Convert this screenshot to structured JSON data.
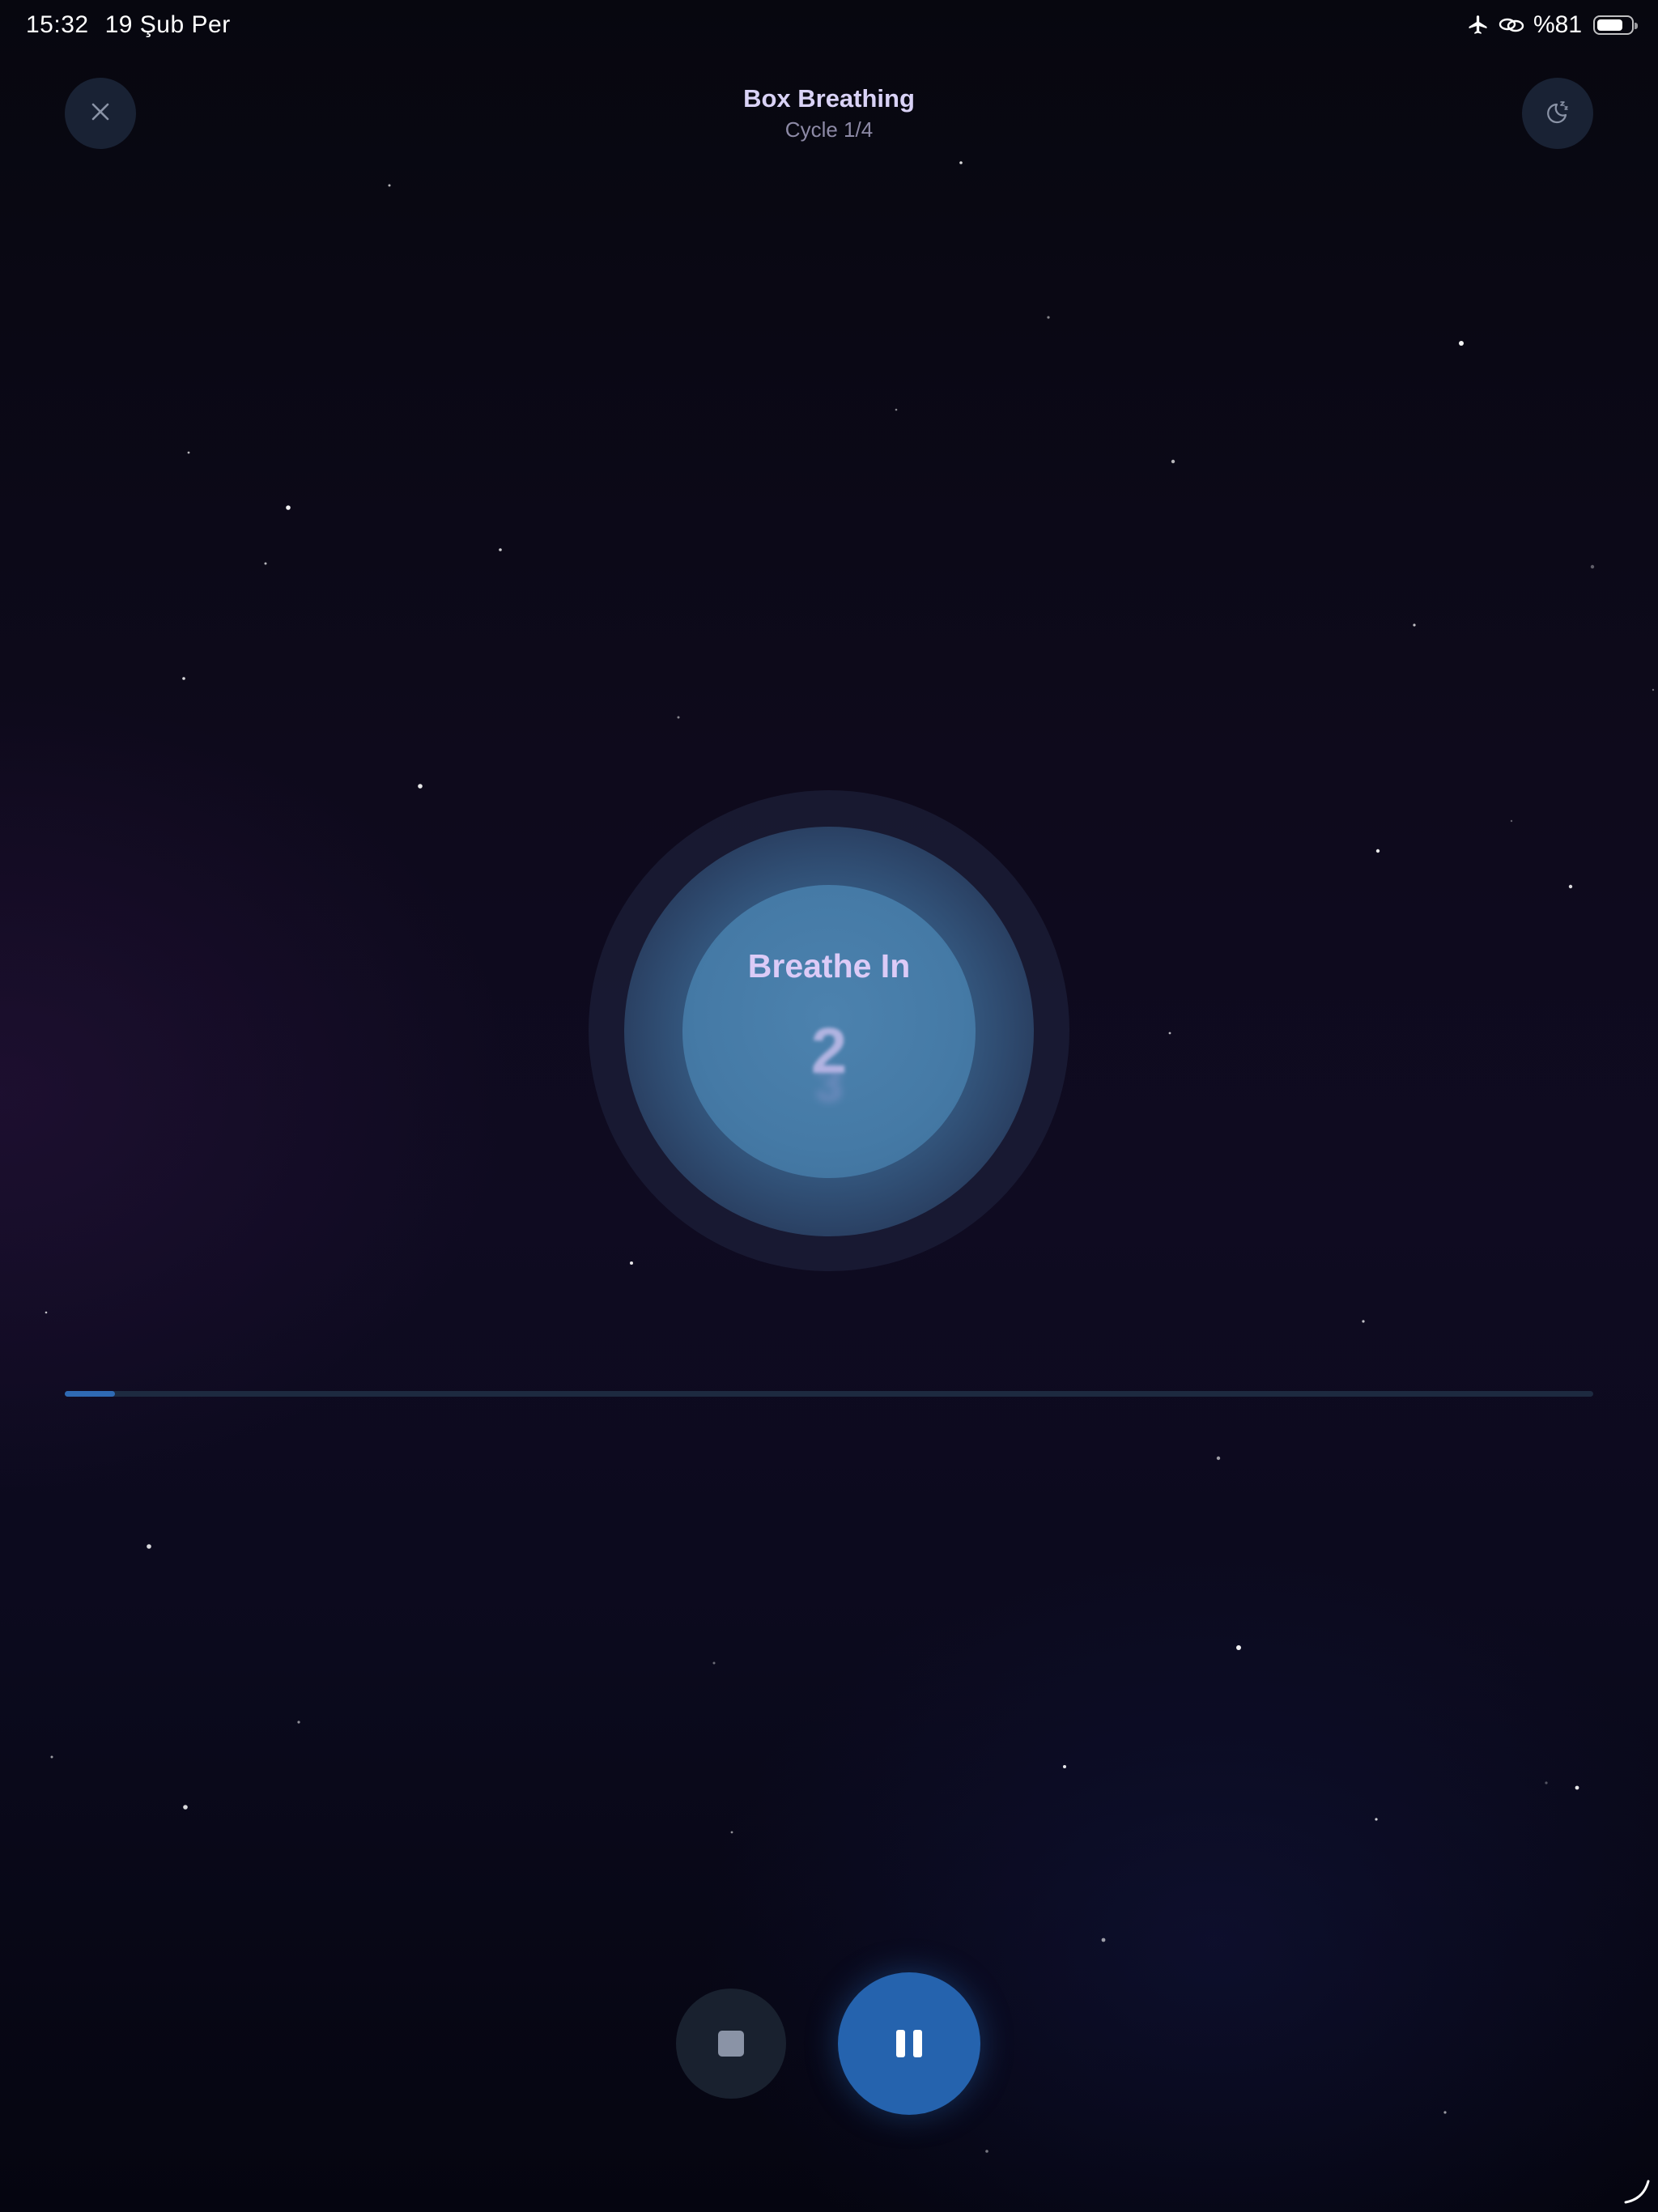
{
  "status_bar": {
    "time": "15:32",
    "date": "19 Şub Per",
    "battery_text": "%81",
    "battery_level": 0.81,
    "icons": [
      "airplane-mode-icon",
      "link-icon",
      "battery-icon"
    ]
  },
  "header": {
    "title": "Box Breathing",
    "subtitle": "Cycle 1/4"
  },
  "top_buttons": {
    "close_icon": "close-icon",
    "sleep_icon": "moon-zzz-icon"
  },
  "orb": {
    "phase": "Breathe In",
    "count": "2",
    "next_count": "3"
  },
  "progress": {
    "fraction": 0.033
  },
  "controls": {
    "stop_icon": "stop-icon",
    "pause_icon": "pause-icon"
  },
  "colors": {
    "accent": "#2563ae",
    "background": "#0a0917",
    "title": "#d9d2f6",
    "phase_text": "#dccbf7",
    "orb": "#4c82ae"
  }
}
